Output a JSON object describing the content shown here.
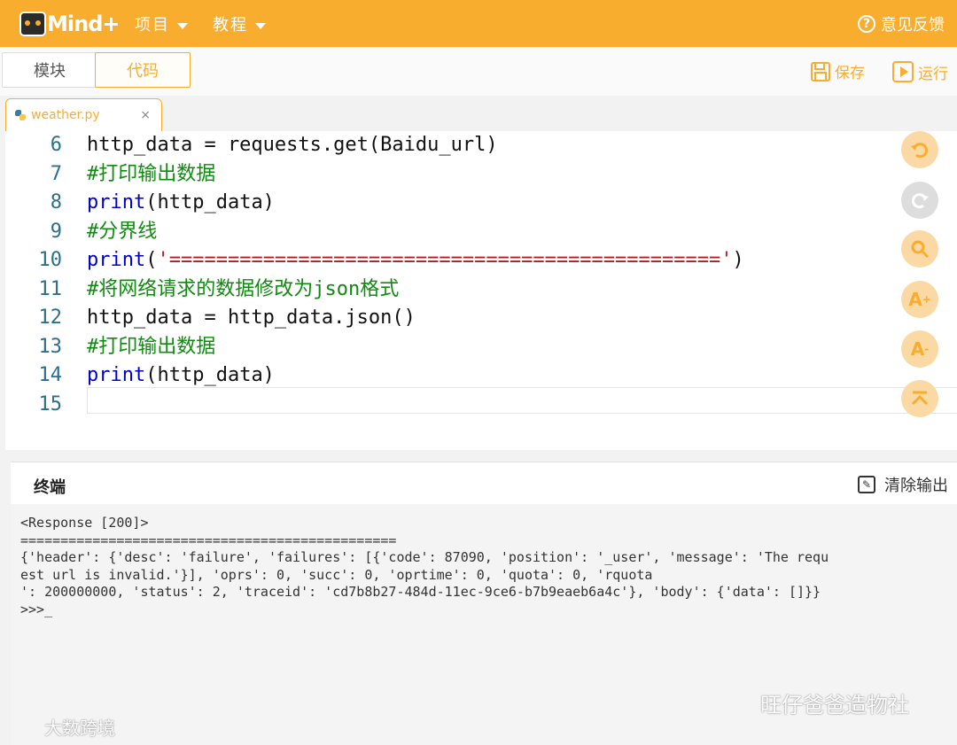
{
  "header": {
    "logo_text": "Mind+",
    "menu": [
      {
        "label": "项目"
      },
      {
        "label": "教程"
      }
    ],
    "feedback_label": "意见反馈"
  },
  "toolbar": {
    "tabs": [
      {
        "label": "模块",
        "active": false
      },
      {
        "label": "代码",
        "active": true
      }
    ],
    "save_label": "保存",
    "run_label": "运行"
  },
  "file_tab": {
    "name": "weather.py",
    "close": "×"
  },
  "editor": {
    "lines": [
      {
        "num": "6",
        "tokens": [
          [
            "",
            "http_data = requests.get(Baidu_url)"
          ]
        ]
      },
      {
        "num": "7",
        "tokens": [
          [
            "cm",
            "#打印输出数据"
          ]
        ]
      },
      {
        "num": "8",
        "tokens": [
          [
            "kw",
            "print"
          ],
          [
            "",
            "(http_data)"
          ]
        ]
      },
      {
        "num": "9",
        "tokens": [
          [
            "cm",
            "#分界线"
          ]
        ]
      },
      {
        "num": "10",
        "tokens": [
          [
            "kw",
            "print"
          ],
          [
            "",
            "("
          ],
          [
            "st",
            "'==============================================='"
          ],
          [
            "",
            ")"
          ]
        ]
      },
      {
        "num": "11",
        "tokens": [
          [
            "cm",
            "#将网络请求的数据修改为json格式"
          ]
        ]
      },
      {
        "num": "12",
        "tokens": [
          [
            "",
            "http_data = http_data.json()"
          ]
        ]
      },
      {
        "num": "13",
        "tokens": [
          [
            "cm",
            "#打印输出数据"
          ]
        ]
      },
      {
        "num": "14",
        "tokens": [
          [
            "kw",
            "print"
          ],
          [
            "",
            "(http_data)"
          ]
        ]
      },
      {
        "num": "15",
        "tokens": [
          [
            "",
            ""
          ]
        ]
      }
    ],
    "side_buttons": [
      "undo-icon",
      "redo-icon",
      "search-icon",
      "font-increase-icon",
      "font-decrease-icon",
      "collapse-top-icon"
    ]
  },
  "terminal": {
    "title": "终端",
    "clear_label": "清除输出",
    "lines": [
      "<Response [200]>",
      "===============================================",
      "{'header': {'desc': 'failure', 'failures': [{'code': 87090, 'position': '_user', 'message': 'The requ",
      "est url is invalid.'}], 'oprs': 0, 'succ': 0, 'oprtime': 0, 'quota': 0, 'rquota",
      "': 200000000, 'status': 2, 'traceid': 'cd7b8b27-484d-11ec-9ce6-b7b9eaeb6a4c'}, 'body': {'data': []}}",
      ">>>_"
    ]
  },
  "watermarks": {
    "left": "大数跨境",
    "right": "旺仔爸爸造物社"
  },
  "colors": {
    "accent": "#f9ad2f",
    "keyword": "#0000d0",
    "comment": "#108a10",
    "string": "#b31c1c",
    "line_number": "#2b6f8c"
  }
}
